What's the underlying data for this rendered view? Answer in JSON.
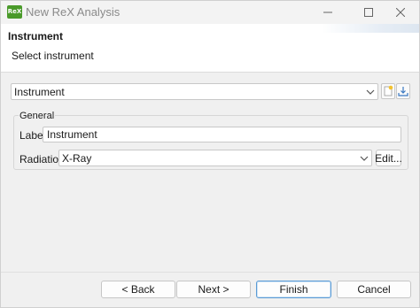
{
  "window": {
    "title": "New ReX Analysis",
    "app_icon_text": "ReX"
  },
  "banner": {
    "title": "Instrument",
    "subtitle": "Select instrument"
  },
  "instrument_selector": {
    "value": "Instrument"
  },
  "group": {
    "title": "General",
    "label_field": {
      "label": "Label",
      "value": "Instrument"
    },
    "radiation_field": {
      "label": "Radiation",
      "value": "X-Ray",
      "edit_label": "Edit..."
    }
  },
  "footer": {
    "back_label": "< Back",
    "next_label": "Next >",
    "finish_label": "Finish",
    "cancel_label": "Cancel"
  },
  "colors": {
    "app_icon": "#4a9a2a",
    "primary_border": "#5a9bd5"
  }
}
